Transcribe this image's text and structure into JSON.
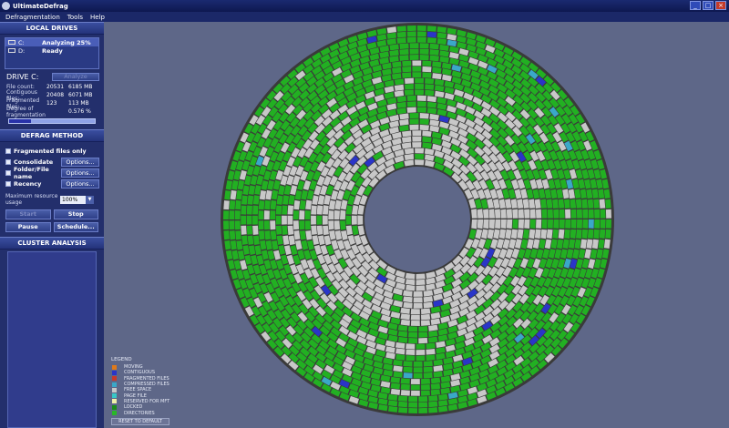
{
  "window": {
    "title": "UltimateDefrag"
  },
  "menu": [
    {
      "label": "Defragmentation"
    },
    {
      "label": "Tools"
    },
    {
      "label": "Help"
    }
  ],
  "local_drives": {
    "title": "LOCAL DRIVES",
    "drives": [
      {
        "letter": "C:",
        "status": "Analyzing 25%"
      },
      {
        "letter": "D:",
        "status": "Ready"
      }
    ]
  },
  "drive_info": {
    "label": "DRIVE C:",
    "analyze_label": "Analyze",
    "stats": [
      {
        "label": "File count:",
        "value": "20531",
        "extra": "6185 MB"
      },
      {
        "label": "Contiguous files:",
        "value": "20408",
        "extra": "6071 MB"
      },
      {
        "label": "Fragmented files:",
        "value": "123",
        "extra": "113 MB"
      },
      {
        "label": "Degree of fragmentation",
        "value": "",
        "extra": "0.576 %"
      }
    ],
    "progress": 0.25
  },
  "defrag_method": {
    "title": "DEFRAG METHOD",
    "fragmented_only": "Fragmented files only",
    "methods": [
      {
        "label": "Consolidate",
        "options": "Options..."
      },
      {
        "label": "Folder/File name",
        "options": "Options..."
      },
      {
        "label": "Recency",
        "options": "Options..."
      }
    ],
    "resource_label": "Maximum resource usage",
    "resource_value": "100%",
    "start": "Start",
    "stop": "Stop",
    "pause": "Pause",
    "schedule": "Schedule..."
  },
  "cluster_analysis": {
    "title": "CLUSTER ANALYSIS"
  },
  "legend": {
    "title": "LEGEND",
    "items": [
      {
        "label": "MOVING",
        "color": "#e07a1a"
      },
      {
        "label": "CONTIGUOUS",
        "color": "#2a35c8"
      },
      {
        "label": "FRAGMENTED FILES",
        "color": "#c8382a"
      },
      {
        "label": "COMPRESSED FILES",
        "color": "#3aa8c8"
      },
      {
        "label": "FREE SPACE",
        "color": "#c8c8c8"
      },
      {
        "label": "PAGE FILE",
        "color": "#38c8c8"
      },
      {
        "label": "RESERVED FOR MFT",
        "color": "#f0f0a8"
      },
      {
        "label": "LOCKED",
        "color": "#1a8c1a"
      },
      {
        "label": "DIRECTORIES",
        "color": "#28b828"
      }
    ],
    "reset": "RESET TO DEFAULT"
  },
  "colors": {
    "used": "#22b022",
    "free": "#c8c8c8",
    "contiguous": "#2a35c8",
    "fragmented": "#c8382a"
  }
}
